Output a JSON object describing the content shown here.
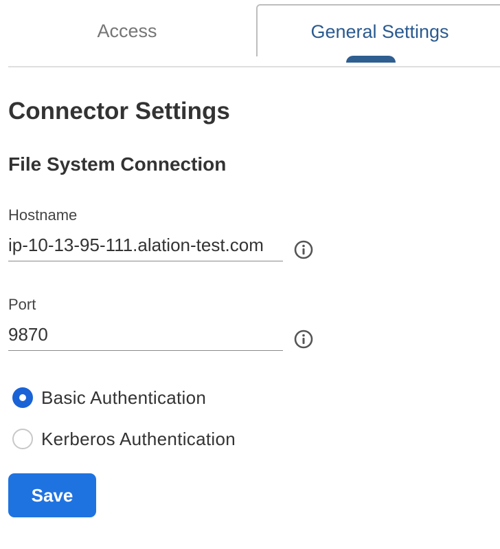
{
  "tabs": {
    "access_label": "Access",
    "general_settings_label": "General Settings",
    "active": "General Settings"
  },
  "page": {
    "title": "Connector Settings",
    "section_title": "File System Connection"
  },
  "hostname": {
    "label": "Hostname",
    "value": "ip-10-13-95-111.alation-test.com",
    "info_icon": "info-icon"
  },
  "port": {
    "label": "Port",
    "value": "9870",
    "info_icon": "info-icon"
  },
  "auth": {
    "options": [
      {
        "label": "Basic Authentication",
        "selected": true
      },
      {
        "label": "Kerberos Authentication",
        "selected": false
      }
    ]
  },
  "actions": {
    "save_label": "Save"
  },
  "colors": {
    "accent": "#1f73e0",
    "active_tab_text": "#2a5a8f",
    "radio_selected": "#1a63d6"
  }
}
